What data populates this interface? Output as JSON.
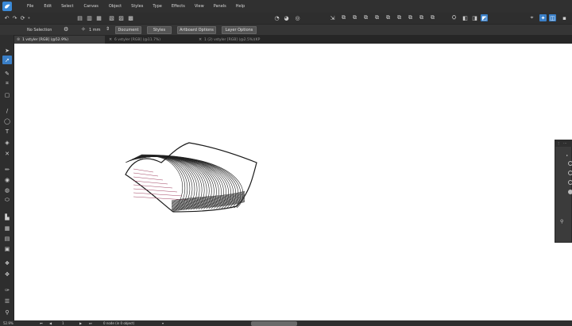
{
  "menu": [
    "File",
    "Edit",
    "Select",
    "Canvas",
    "Object",
    "Styles",
    "Type",
    "Effects",
    "View",
    "Panels",
    "Help"
  ],
  "context": {
    "selection": "No Selection",
    "stroke_width": "1 mm",
    "document_button": "Document",
    "styles_button": "Styles",
    "artboard_button": "Artboard Options",
    "layer_button": "Layer Options"
  },
  "tabs": [
    {
      "label": "1 vstyler [RGB] (@52.9%)",
      "active": true
    },
    {
      "label": "6 vstyler [RGB] (@11.7%)",
      "active": false
    },
    {
      "label": "1 (2) vstyler [RGB] (@2.5%)(KP",
      "active": false
    }
  ],
  "status": {
    "zoom": "52.9%",
    "page": "1",
    "selection_info": "0 node (in 0 object)"
  },
  "icons": {
    "logo": "bird-logo-icon",
    "accent": "#3a7fc7"
  }
}
